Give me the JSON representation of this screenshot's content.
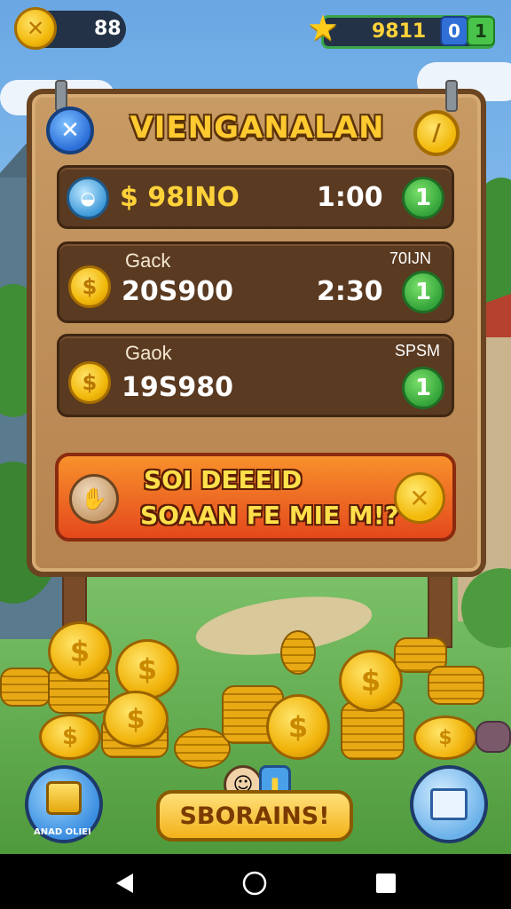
{
  "hud": {
    "coin_count": "88",
    "level_value": "9811",
    "toggle_blue": "0",
    "toggle_green": "1"
  },
  "board": {
    "title": "VIENGANALAN"
  },
  "rows": [
    {
      "label": "",
      "amount": "$ 98INO",
      "time": "1:00",
      "tag": "",
      "button": "1"
    },
    {
      "label": "Gack",
      "amount": "20S900",
      "time": "2:30",
      "tag": "70IJN",
      "button": "1"
    },
    {
      "label": "Gaok",
      "amount": "19S980",
      "time": "",
      "tag": "SPSM",
      "button": "1"
    }
  ],
  "banner": {
    "line1": "SOI   DEEEID",
    "line2": "SOAAN  FE MIE M!?"
  },
  "bottom": {
    "left_label": "ANAD OLIEI",
    "main_button": "SBORAINS!"
  },
  "colors": {
    "accent_gold": "#f2b90c",
    "board_wood": "#b5834f",
    "row_dark": "#5a3a21",
    "banner_orange": "#e4481c",
    "confirm_green": "#34a43a"
  }
}
